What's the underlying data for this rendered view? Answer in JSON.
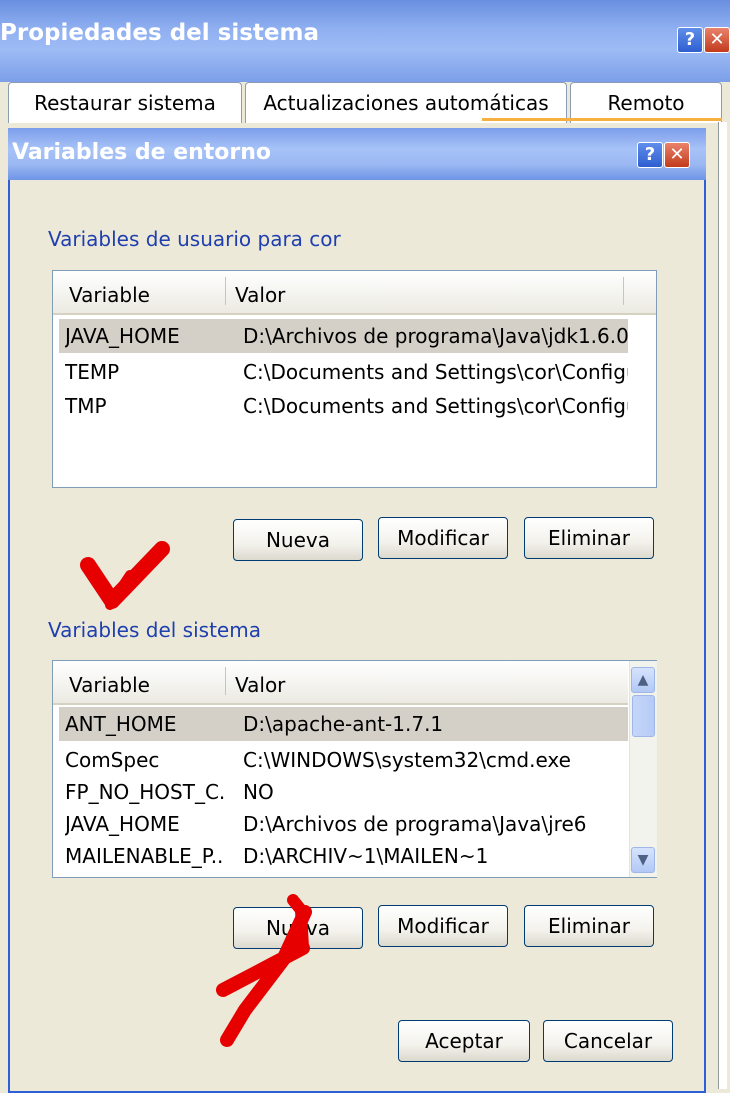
{
  "outer_window": {
    "title": "Propiedades del sistema",
    "help_label": "?",
    "close_label": "✕",
    "tabs": [
      {
        "label": "Restaurar sistema"
      },
      {
        "label": "Actualizaciones automáticas"
      },
      {
        "label": "Remoto"
      }
    ]
  },
  "dialog": {
    "title": "Variables de entorno",
    "help_label": "?",
    "close_label": "✕",
    "user_vars": {
      "label": "Variables de usuario para cor",
      "columns": {
        "variable": "Variable",
        "valor": "Valor"
      },
      "rows": [
        {
          "variable": "JAVA_HOME",
          "valor": "D:\\Archivos de programa\\Java\\jdk1.6.0..."
        },
        {
          "variable": "TEMP",
          "valor": "C:\\Documents and Settings\\cor\\Configu..."
        },
        {
          "variable": "TMP",
          "valor": "C:\\Documents and Settings\\cor\\Configu..."
        }
      ],
      "buttons": {
        "new": "Nueva",
        "edit": "Modificar",
        "delete": "Eliminar"
      }
    },
    "system_vars": {
      "label": "Variables del sistema",
      "columns": {
        "variable": "Variable",
        "valor": "Valor"
      },
      "rows": [
        {
          "variable": "ANT_HOME",
          "valor": "D:\\apache-ant-1.7.1"
        },
        {
          "variable": "ComSpec",
          "valor": "C:\\WINDOWS\\system32\\cmd.exe"
        },
        {
          "variable": "FP_NO_HOST_C...",
          "valor": "NO"
        },
        {
          "variable": "JAVA_HOME",
          "valor": "D:\\Archivos de programa\\Java\\jre6"
        },
        {
          "variable": "MAILENABLE_P...",
          "valor": "D:\\ARCHIV~1\\MAILEN~1"
        }
      ],
      "scroll_up": "▲",
      "scroll_down": "▼",
      "buttons": {
        "new": "Nueva",
        "edit": "Modificar",
        "delete": "Eliminar"
      }
    },
    "ok": "Aceptar",
    "cancel": "Cancelar"
  },
  "colors": {
    "annotation_arrow": "#E60000",
    "title_bar": "#6A8FE0",
    "group_label": "#1F3FAF"
  }
}
